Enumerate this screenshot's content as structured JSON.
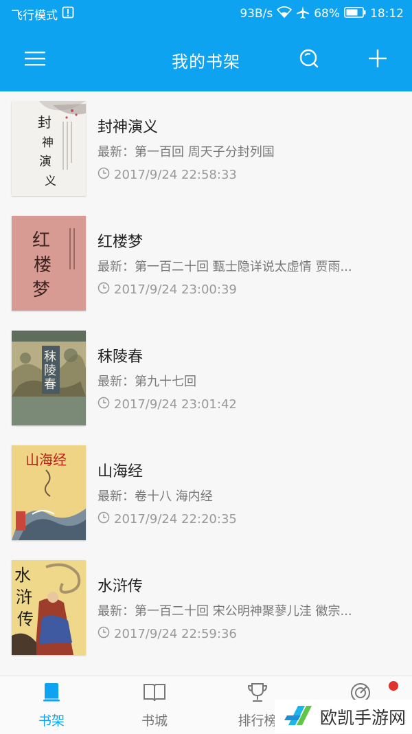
{
  "status": {
    "mode": "飞行模式",
    "speed": "93B/s",
    "battery": "68%",
    "time": "18:12"
  },
  "header": {
    "title": "我的书架",
    "menu_icon": "menu-icon",
    "search_icon": "search-icon",
    "add_icon": "add-icon",
    "bg_color": "#0ea3f0"
  },
  "books": [
    {
      "title": "封神演义",
      "latest": "最新：第一百回 周天子分封列国",
      "time": "2017/9/24 22:58:33",
      "cover_text": "封神演义"
    },
    {
      "title": "红楼梦",
      "latest": "最新：第一百二十回 甄士隐详说太虚情 贾雨...",
      "time": "2017/9/24 23:00:39",
      "cover_text": "红楼梦"
    },
    {
      "title": "秣陵春",
      "latest": "最新：第九十七回",
      "time": "2017/9/24 23:01:42",
      "cover_text": "秣陵春"
    },
    {
      "title": "山海经",
      "latest": "最新：卷十八 海内经",
      "time": "2017/9/24 22:20:35",
      "cover_text": "山海经"
    },
    {
      "title": "水浒传",
      "latest": "最新：第一百二十回 宋公明神聚蓼儿洼 徽宗...",
      "time": "2017/9/24 22:59:36",
      "cover_text": "水浒传"
    }
  ],
  "tabs": [
    {
      "label": "书架",
      "icon": "bookshelf-icon",
      "active": true
    },
    {
      "label": "书城",
      "icon": "open-book-icon",
      "active": false
    },
    {
      "label": "排行榜",
      "icon": "trophy-icon",
      "active": false
    },
    {
      "label": "",
      "icon": "discover-icon",
      "active": false
    }
  ],
  "watermark": {
    "text": "欧凯手游网"
  }
}
